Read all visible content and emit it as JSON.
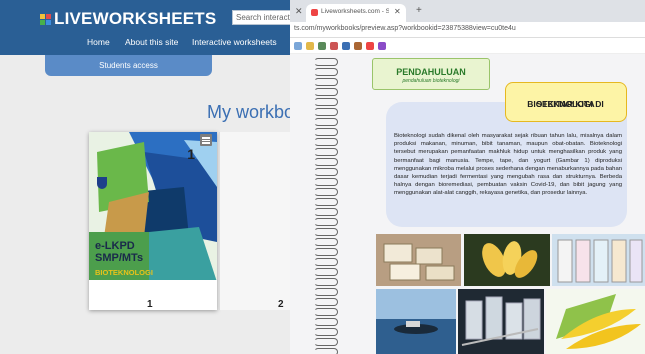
{
  "liveworksheets": {
    "logo_text": "LIVEWORKSHEETS",
    "search_placeholder": "Search interact",
    "nav": [
      "Home",
      "About this site",
      "Interactive worksheets"
    ],
    "students_access": "Students access",
    "my_workbooks_heading": "My workbo",
    "book": {
      "number_top": "1",
      "title_line1": "e-LKPD",
      "title_line2": "SMP/MTs",
      "subtitle": "BIOTEKNOLOGI",
      "position_label": "1"
    },
    "second_book_label": "2"
  },
  "browser": {
    "tab_title": "Liveworksheets.com - Student w",
    "url": "ts.com/myworkbooks/preview.asp?workbookid=23875388view=cu0te4u",
    "page": {
      "banner_label": "PENDAHULUAN",
      "banner_sublabel": "pendahuluan bioteknologi",
      "section_title_line1": "BIOTEKNOLOGI DI",
      "section_title_line2": "SEKITAR KITA",
      "body_text": "Bioteknologi sudah dikenal oleh masyarakat sejak ribuan tahun lalu, misalnya dalam produksi makanan, minuman, bibit tanaman, maupun obat-obatan. Bioteknologi tersebut merupakan pemanfaatan makhluk hidup untuk menghasilkan produk yang bermanfaat bagi manusia. Tempe, tape, dan yogurt (Gambar 1) diproduksi menggunakan mikroba melalui proses sederhana dengan menaburkannya pada bahan dasar kemudian terjadi fermentasi yang mengubah rasa dan strukturnya. Berbeda halnya dengan bioremediasi, pembuatan vaksin Covid-19, dan bibit jagung yang menggunakan alat-alat canggih, rekayasa genetika, dan prosedur lainnya."
    }
  },
  "colors": {
    "lw_header": "#2a5f95",
    "lw_students": "#5a8bc7",
    "lw_heading": "#3b6fb3",
    "title_box_fill": "#fdf4a6",
    "info_box_fill": "#dde4f4"
  }
}
